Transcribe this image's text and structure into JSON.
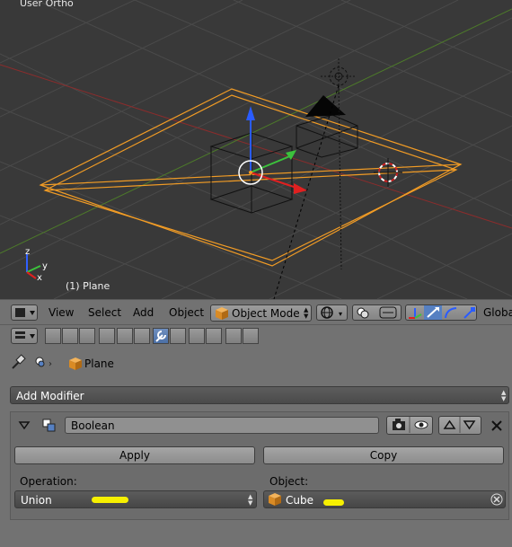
{
  "viewport": {
    "title": "User Ortho",
    "object_label": "(1) Plane",
    "axis_labels": {
      "z": "z",
      "x": "x",
      "y": "y"
    }
  },
  "header3d": {
    "menu": [
      "View",
      "Select",
      "Add",
      "Object"
    ],
    "mode": "Object Mode",
    "orientation": "Global"
  },
  "breadcrumb": {
    "object": "Plane"
  },
  "modifier": {
    "add_label": "Add Modifier",
    "name": "Boolean",
    "apply_label": "Apply",
    "copy_label": "Copy",
    "operation_label": "Operation:",
    "operation_value": "Union",
    "object_label": "Object:",
    "object_value": "Cube"
  },
  "colors": {
    "viewport_bg": "#393939",
    "selection_orange": "#f29c25",
    "panel_bg": "#727272",
    "highlight": "#f7f000",
    "active_tab": "#5680c2"
  }
}
